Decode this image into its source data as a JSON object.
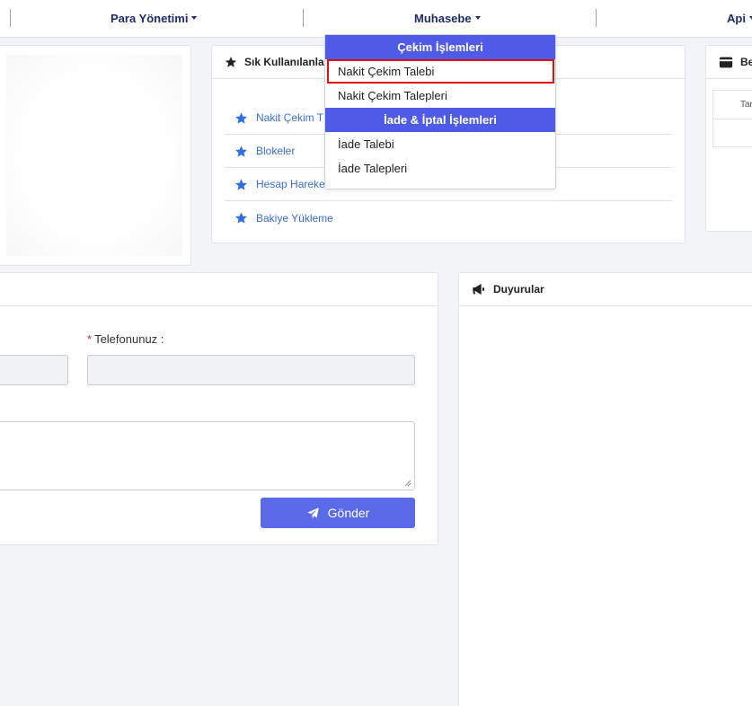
{
  "nav": {
    "items": [
      "Para Yönetimi",
      "Muhasebe",
      "Api"
    ]
  },
  "favorites": {
    "title": "Sık Kullanılanla",
    "items": [
      "Nakit Çekim T",
      "Blokeler",
      "Hesap Hareke",
      "Bakiye Yükleme"
    ]
  },
  "dropdown": {
    "section1": "Çekim İşlemleri",
    "items1": [
      "Nakit Çekim Talebi",
      "Nakit Çekim Talepleri"
    ],
    "section2": "İade & İptal İşlemleri",
    "items2": [
      "İade Talebi",
      "İade Talepleri"
    ]
  },
  "balance_card": {
    "title": "Be",
    "table_header": "Tar"
  },
  "form": {
    "phone_label": "Telefonunuz :",
    "send_label": "Gönder"
  },
  "announcements": {
    "title": "Duyurular"
  },
  "colors": {
    "accent": "#4f5be7",
    "button": "#5a6ae8",
    "link": "#3a6fd8",
    "highlight": "#e01010"
  }
}
